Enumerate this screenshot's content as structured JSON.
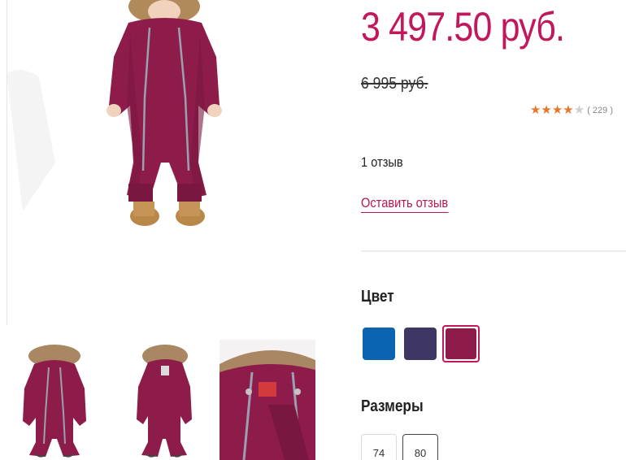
{
  "product": {
    "price": "3 497.50 руб.",
    "old_price": "6 995 руб.",
    "rating_value": 4,
    "rating_max": 5,
    "rating_count": "( 229 )",
    "reviews_count": "1 отзыв",
    "leave_review_label": "Оставить отзыв"
  },
  "color_section": {
    "title": "Цвет",
    "swatches": [
      {
        "color": "#0a64b0",
        "selected": false
      },
      {
        "color": "#3e3766",
        "selected": false
      },
      {
        "color": "#8e1c4b",
        "selected": true
      }
    ]
  },
  "sizes_section": {
    "title": "Размеры",
    "options": [
      {
        "label": "74",
        "selected": false
      },
      {
        "label": "80",
        "selected": true
      }
    ]
  },
  "colors": {
    "price_accent": "#c2185b",
    "link_accent": "#b8174f",
    "star_on": "#e8762b",
    "star_off": "#cfcfcf"
  },
  "icons": [
    "star-icon"
  ]
}
